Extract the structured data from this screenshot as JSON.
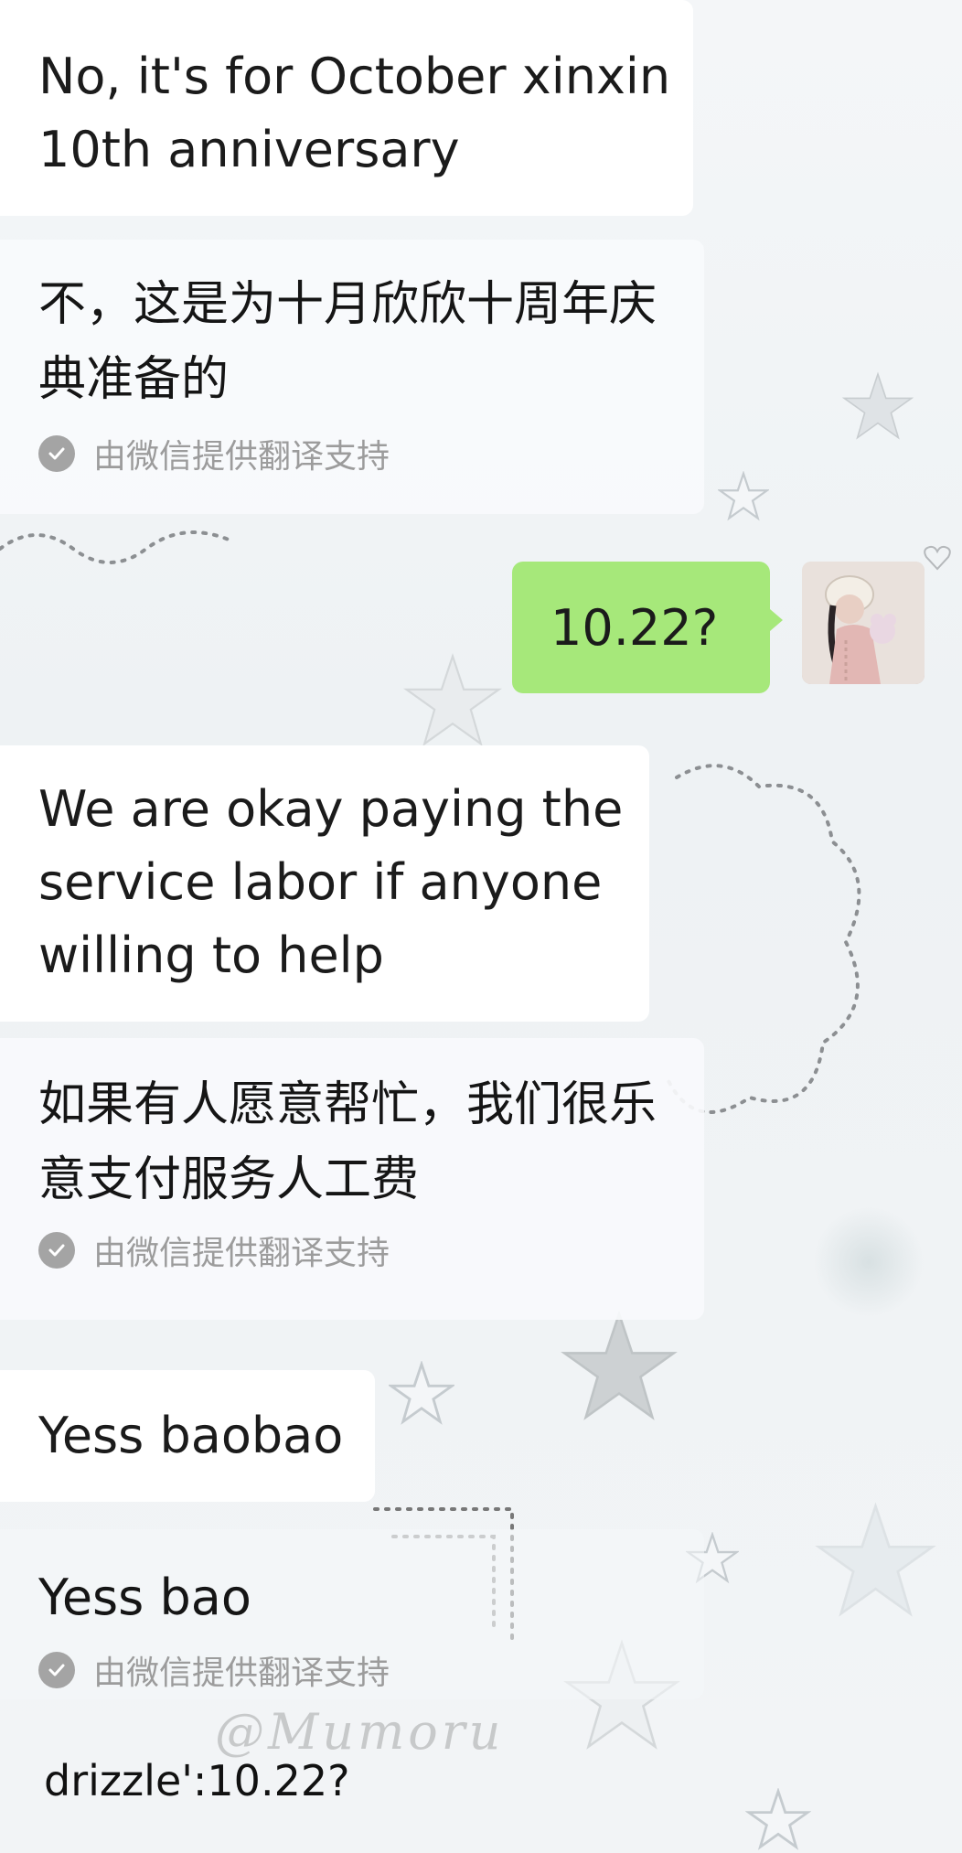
{
  "messages": [
    {
      "sender": "other",
      "text": "No, it's for October xinxin 10th anniversary",
      "translation": "不，这是为十月欣欣十周年庆典准备的",
      "translation_credit": "由微信提供翻译支持"
    },
    {
      "sender": "me",
      "text": "10.22?"
    },
    {
      "sender": "other",
      "text": "We are okay paying the service labor if anyone willing to help",
      "translation": "如果有人愿意帮忙，我们很乐意支付服务人工费",
      "translation_credit": "由微信提供翻译支持"
    },
    {
      "sender": "other",
      "text": "Yess baobao",
      "translation": "Yess bao",
      "translation_credit": "由微信提供翻译支持"
    }
  ],
  "watermark": "@Mumoru",
  "caption": "drizzle':10.22?",
  "colors": {
    "outgoing_bubble": "#a6e87a",
    "incoming_bubble": "#ffffff",
    "translation_card": "#f8fafc",
    "credit_text": "#9c9c9c"
  },
  "icons": {
    "translation_check": "check-circle-icon",
    "avatar": "user-avatar"
  }
}
